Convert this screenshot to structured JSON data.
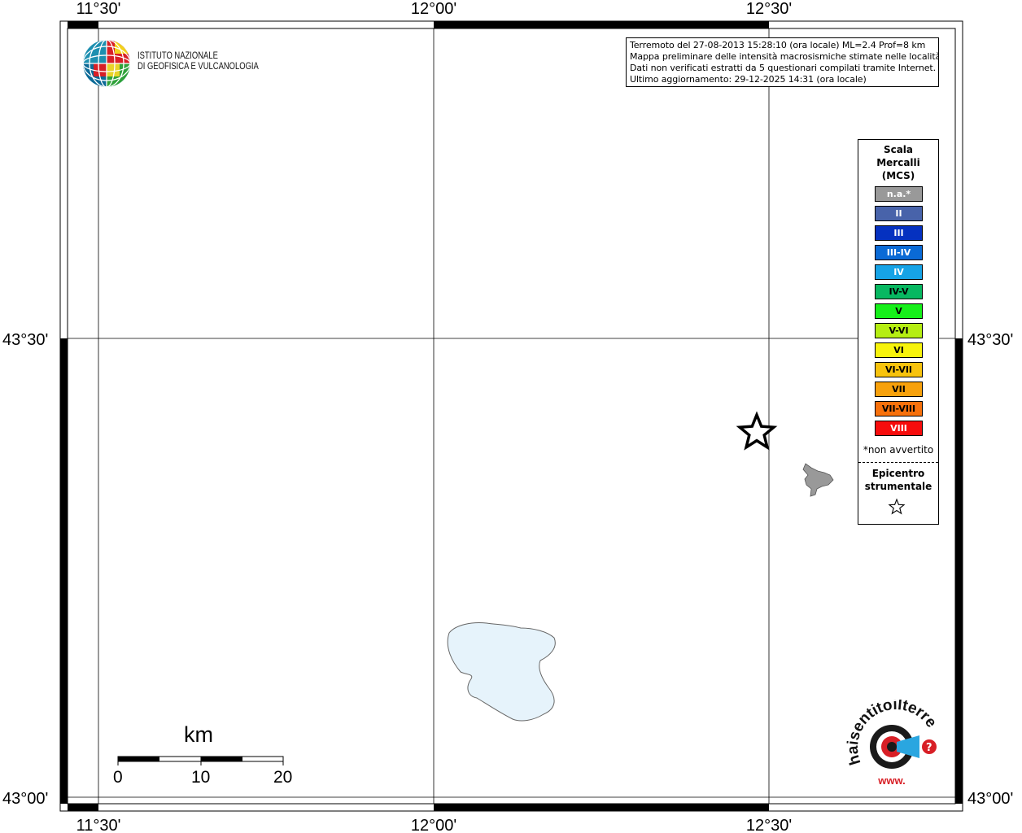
{
  "map": {
    "graticule": {
      "longitudes": [
        "11°30'",
        "12°00'",
        "12°30'"
      ],
      "latitudes": [
        "43°30'",
        "43°00'"
      ]
    },
    "features": {
      "epicenter": "star-marker",
      "lake": "lake-polygon",
      "locality": "intensity-polygon-na"
    },
    "colors": {
      "water": "#e6f3fb",
      "locality_na": "#999999"
    }
  },
  "institute": {
    "name_line1": "ISTITUTO NAZIONALE",
    "name_line2": "DI GEOFISICA E VULCANOLOGIA"
  },
  "info": {
    "line1": "Terremoto del 27-08-2013 15:28:10 (ora locale) ML=2.4 Prof=8 km",
    "line2": "Mappa preliminare delle intensità macrosismiche stimate nelle località",
    "line3": "Dati non verificati estratti da 5 questionari compilati tramite Internet.",
    "line4": "Ultimo aggiornamento: 29-12-2025 14:31 (ora locale)"
  },
  "legend": {
    "title_line1": "Scala",
    "title_line2": "Mercalli",
    "title_line3": "(MCS)",
    "items": [
      {
        "label": "n.a.*",
        "color": "#999999",
        "text_color": "#ffffff"
      },
      {
        "label": "II",
        "color": "#4863aa",
        "text_color": "#ffffff"
      },
      {
        "label": "III",
        "color": "#0531c0",
        "text_color": "#ffffff"
      },
      {
        "label": "III-IV",
        "color": "#0a6ad6",
        "text_color": "#ffffff"
      },
      {
        "label": "IV",
        "color": "#16a3e6",
        "text_color": "#ffffff"
      },
      {
        "label": "IV-V",
        "color": "#07b861",
        "text_color": "#000000"
      },
      {
        "label": "V",
        "color": "#16f01a",
        "text_color": "#000000"
      },
      {
        "label": "V-VI",
        "color": "#b5ee12",
        "text_color": "#000000"
      },
      {
        "label": "VI",
        "color": "#f7f30c",
        "text_color": "#000000"
      },
      {
        "label": "VI-VII",
        "color": "#f7c30d",
        "text_color": "#000000"
      },
      {
        "label": "VII",
        "color": "#f7a10c",
        "text_color": "#000000"
      },
      {
        "label": "VII-VIII",
        "color": "#f7710c",
        "text_color": "#000000"
      },
      {
        "label": "VIII",
        "color": "#f70c0c",
        "text_color": "#ffffff"
      }
    ],
    "note": "*non avvertito",
    "epicenter_line1": "Epicentro",
    "epicenter_line2": "strumentale"
  },
  "scale_bar": {
    "title": "km",
    "labels": [
      "0",
      "10",
      "20"
    ]
  },
  "haisentito": {
    "text": "haisentitoilterremoto.it",
    "www": "www."
  }
}
